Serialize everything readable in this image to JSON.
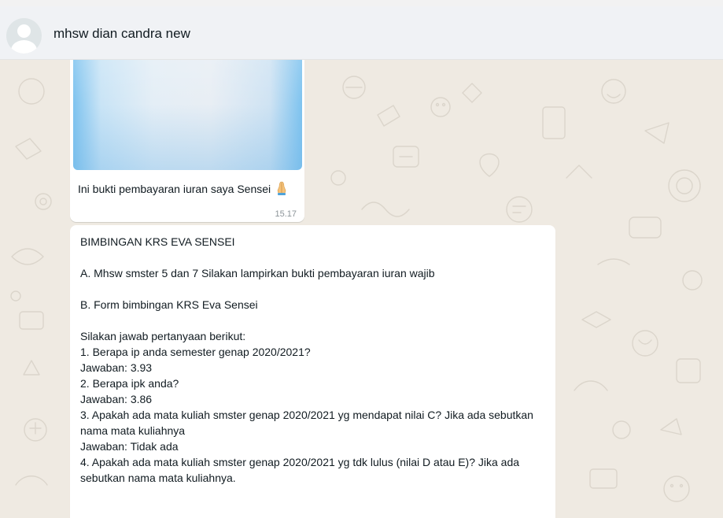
{
  "header": {
    "contact_name": "mhsw dian candra new",
    "avatar_icon": "default-user-avatar-icon"
  },
  "colors": {
    "header_bg": "#f0f2f5",
    "chat_bg": "#efeae2",
    "bubble_bg": "#ffffff",
    "text": "#111b21",
    "timestamp": "#8c9499"
  },
  "messages": [
    {
      "type": "image",
      "caption_text": "Ini bukti pembayaran iuran saya Sensei",
      "caption_emoji_icon": "folded-hands-icon",
      "time": "15.17"
    },
    {
      "type": "text",
      "lines": [
        "BIMBINGAN KRS EVA SENSEI",
        "",
        "A. Mhsw smster 5 dan 7 Silakan lampirkan bukti pembayaran iuran wajib",
        "",
        "B. Form bimbingan KRS Eva Sensei",
        "",
        "Silakan jawab pertanyaan berikut:",
        "1. Berapa ip anda semester genap 2020/2021?",
        "Jawaban: 3.93",
        "2. Berapa ipk anda?",
        "Jawaban: 3.86",
        "3. Apakah ada mata kuliah smster genap 2020/2021 yg mendapat nilai C? Jika ada sebutkan nama mata kuliahnya",
        "Jawaban: Tidak ada",
        "4. Apakah ada mata kuliah smster genap 2020/2021 yg tdk lulus (nilai D atau E)? Jika ada sebutkan nama mata kuliahnya."
      ]
    }
  ]
}
